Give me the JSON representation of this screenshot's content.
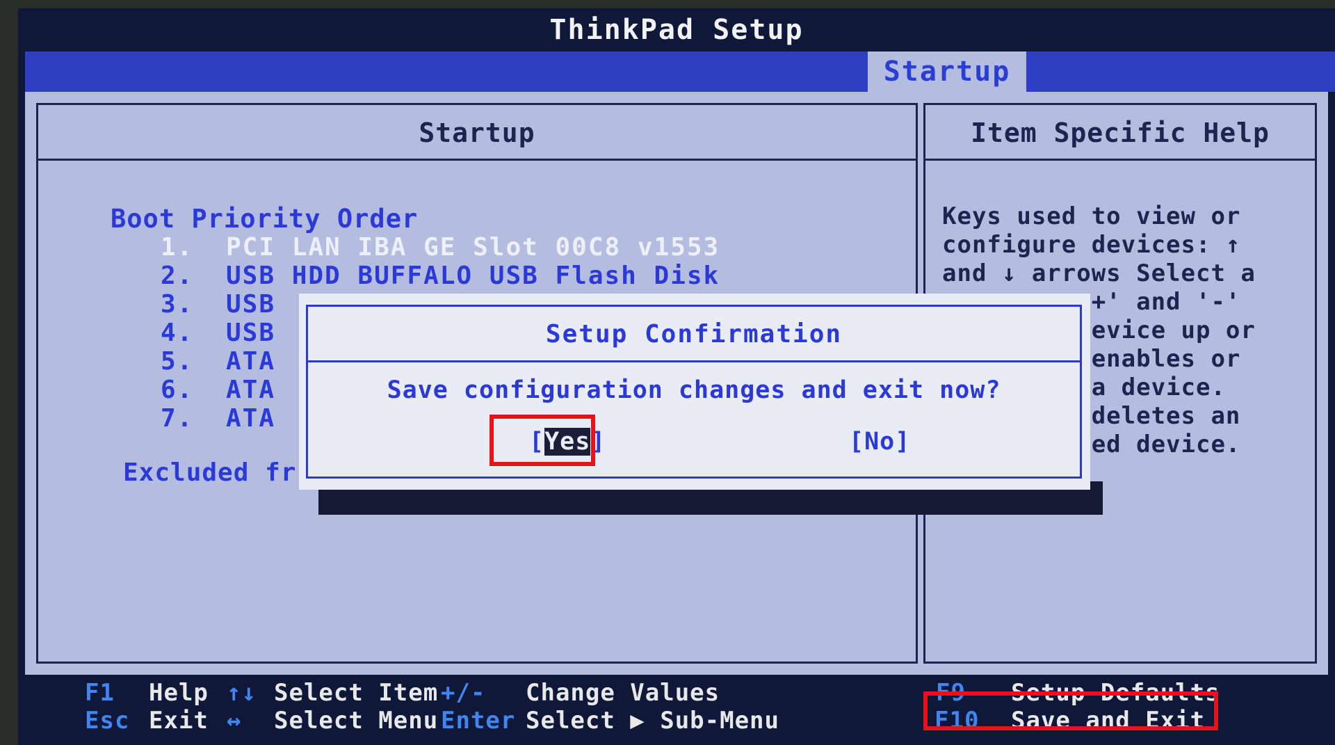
{
  "title": "ThinkPad Setup",
  "active_tab": "Startup",
  "left_panel": {
    "heading": "Startup",
    "boot_title": "Boot Priority Order",
    "boot_items": [
      {
        "num": "1.",
        "label": "PCI LAN IBA GE Slot 00C8 v1553"
      },
      {
        "num": "2.",
        "label": "USB HDD BUFFALO USB Flash Disk"
      },
      {
        "num": "3.",
        "label": "USB"
      },
      {
        "num": "4.",
        "label": "USB"
      },
      {
        "num": "5.",
        "label": "ATA"
      },
      {
        "num": "6.",
        "label": "ATA"
      },
      {
        "num": "7.",
        "label": "ATA"
      }
    ],
    "excluded": "Excluded fr"
  },
  "right_panel": {
    "heading": "Item Specific Help",
    "help_lines": [
      "Keys used to view or",
      "configure devices: ↑",
      "and ↓ arrows Select a",
      "          +' and '-'",
      "          evice up or",
      "          enables or",
      "          a device.",
      "          deletes an",
      "          ed device."
    ]
  },
  "dialog": {
    "title": "Setup Confirmation",
    "question": "Save configuration changes and exit now?",
    "yes_open": "[",
    "yes_label": "Yes",
    "yes_close": "]",
    "no_label": "[No]"
  },
  "footer": {
    "row1": [
      {
        "key": "F1",
        "desc": "Help"
      },
      {
        "key": "↑↓",
        "desc": "Select Item"
      },
      {
        "key": "+/-",
        "desc": "Change Values"
      },
      {
        "key": "F9",
        "desc": "Setup Defaults"
      }
    ],
    "row2": [
      {
        "key": "Esc",
        "desc": "Exit"
      },
      {
        "key": "↔",
        "desc": "Select Menu"
      },
      {
        "key": "Enter",
        "desc": "Select ▶ Sub-Menu"
      },
      {
        "key": "F10",
        "desc": "Save and Exit"
      }
    ]
  },
  "colors": {
    "bios_background": "#b4bddf",
    "title_bar": "#10183a",
    "tab_strip": "#2e3fc4",
    "text_blue": "#2b39d8",
    "highlight_red": "#e5141b"
  }
}
